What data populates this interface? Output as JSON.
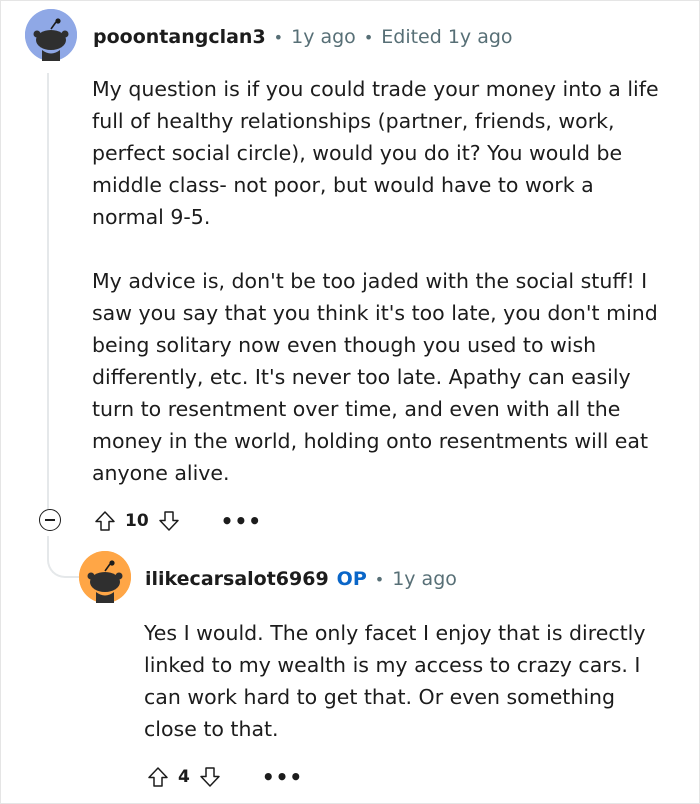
{
  "comment": {
    "username": "pooontangclan3",
    "age": "1y ago",
    "edited": "Edited 1y ago",
    "paragraphs": [
      "My question is if you could trade your money into a life full of healthy relationships (partner, friends, work, perfect social circle), would you do it? You would be middle class- not poor, but would have to work a normal 9-5.",
      "My advice is, don't be too jaded with the social stuff! I saw you say that you think it's too late, you don't mind being solitary now even though you used to wish differently, etc. It's never too late. Apathy can easily turn to resentment over time, and even with all the money in the world, holding onto resentments will eat anyone alive."
    ],
    "score": "10",
    "more": "•••",
    "avatar_color": "#8fa8e6"
  },
  "reply": {
    "username": "ilikecarsalot6969",
    "op_badge": "OP",
    "age": "1y ago",
    "text": "Yes I would. The only facet I enjoy that is directly linked to my wealth is my access to crazy cars. I can work hard to get that. Or even something close to that.",
    "score": "4",
    "more": "•••",
    "avatar_color": "#ffa646"
  },
  "separator": "•",
  "icons": [
    "collapse-icon",
    "upvote-icon",
    "downvote-icon",
    "more-options-icon"
  ]
}
